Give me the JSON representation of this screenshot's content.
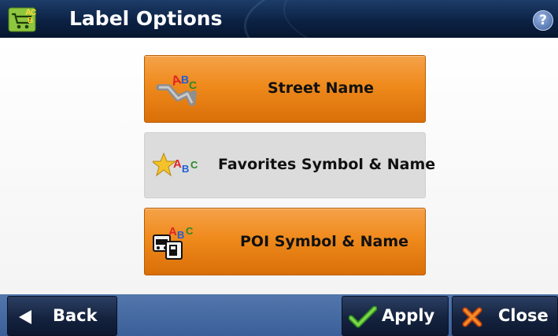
{
  "window": {
    "title": "Label Options",
    "help_glyph": "?"
  },
  "options": [
    {
      "label": "Street Name",
      "icon": "street-abc-icon",
      "state": "selected"
    },
    {
      "label": "Favorites Symbol & Name",
      "icon": "favorites-star-abc-icon",
      "state": "unselected"
    },
    {
      "label": "POI Symbol & Name",
      "icon": "poi-abc-icon",
      "state": "selected"
    }
  ],
  "footer": {
    "back_label": "Back",
    "apply_label": "Apply",
    "close_label": "Close"
  },
  "colors": {
    "selected": "#ef8a1c",
    "unselected": "#dcdcdc",
    "titlebar": "#0c2244",
    "footer": "#4a6ea5"
  }
}
